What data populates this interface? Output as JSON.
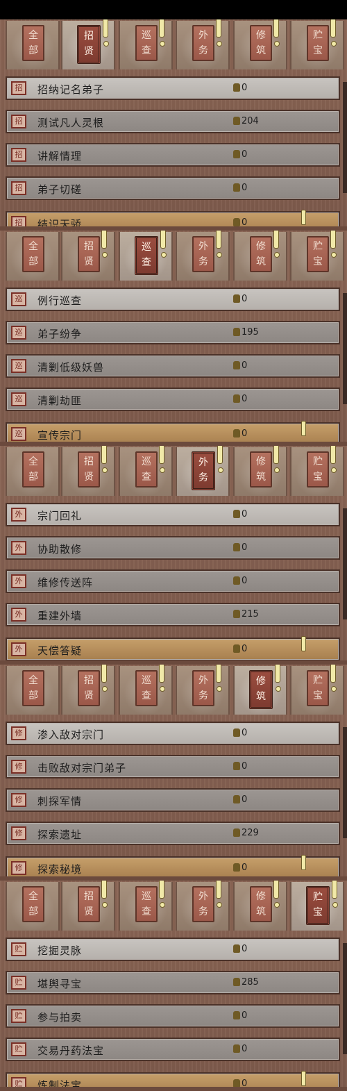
{
  "tabs": [
    {
      "id": "all",
      "label": "全部",
      "l1": "全",
      "l2": "部"
    },
    {
      "id": "recruit",
      "label": "招贤",
      "l1": "招",
      "l2": "贤"
    },
    {
      "id": "patrol",
      "label": "巡查",
      "l1": "巡",
      "l2": "查"
    },
    {
      "id": "diplomacy",
      "label": "外务",
      "l1": "外",
      "l2": "务"
    },
    {
      "id": "cultivate",
      "label": "修筑",
      "l1": "修",
      "l2": "筑"
    },
    {
      "id": "treasure",
      "label": "贮宝",
      "l1": "贮",
      "l2": "宝"
    }
  ],
  "panels": [
    {
      "active_tab": "recruit",
      "row_icon": "招",
      "rows": [
        {
          "title": "招纳记名弟子",
          "count": "0",
          "highlight": true
        },
        {
          "title": "测试凡人灵根",
          "count": "204"
        },
        {
          "title": "讲解情理",
          "count": "0"
        },
        {
          "title": "弟子切磋",
          "count": "0"
        },
        {
          "title": "结识天骄",
          "count": "0",
          "partial": true
        }
      ]
    },
    {
      "active_tab": "patrol",
      "row_icon": "巡",
      "rows": [
        {
          "title": "例行巡查",
          "count": "0",
          "highlight": true
        },
        {
          "title": "弟子纷争",
          "count": "195"
        },
        {
          "title": "清剿低级妖兽",
          "count": "0"
        },
        {
          "title": "清剿劫匪",
          "count": "0"
        },
        {
          "title": "宣传宗门",
          "count": "0",
          "partial": true
        }
      ]
    },
    {
      "active_tab": "diplomacy",
      "row_icon": "外",
      "rows": [
        {
          "title": "宗门回礼",
          "count": "0",
          "highlight": true
        },
        {
          "title": "协助散修",
          "count": "0"
        },
        {
          "title": "维修传送阵",
          "count": "0"
        },
        {
          "title": "重建外墙",
          "count": "215"
        },
        {
          "title": "天偿答疑",
          "count": "0",
          "partial": true
        }
      ]
    },
    {
      "active_tab": "cultivate",
      "row_icon": "修",
      "rows": [
        {
          "title": "渗入敌对宗门",
          "count": "0",
          "highlight": true
        },
        {
          "title": "击败敌对宗门弟子",
          "count": "0"
        },
        {
          "title": "刺探军情",
          "count": "0"
        },
        {
          "title": "探索遗址",
          "count": "229"
        },
        {
          "title": "探索秘境",
          "count": "0",
          "partial": true
        }
      ]
    },
    {
      "active_tab": "treasure",
      "row_icon": "贮",
      "rows": [
        {
          "title": "挖掘灵脉",
          "count": "0",
          "highlight": true
        },
        {
          "title": "堪舆寻宝",
          "count": "285"
        },
        {
          "title": "参与拍卖",
          "count": "0"
        },
        {
          "title": "交易丹药法宝",
          "count": "0"
        },
        {
          "title": "炼制法宝",
          "count": "0",
          "partial": true
        }
      ]
    }
  ],
  "colors": {
    "accent": "#f1e9a8",
    "plate": "#9b5849",
    "row": "#8d8783"
  }
}
